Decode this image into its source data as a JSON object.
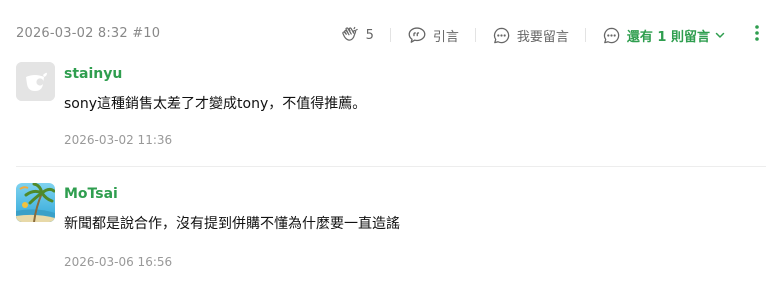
{
  "post": {
    "meta": "2026-03-02 8:32 #10",
    "clap_count": "5",
    "quote_label": "引言",
    "reply_label": "我要留言",
    "more_replies_label": "還有 1 則留言",
    "icons": [
      "clap-icon",
      "quote-icon",
      "comment-icon",
      "chevron-down-icon",
      "more-vertical-icon"
    ],
    "accent_color": "#2f9e4f"
  },
  "replies": [
    {
      "username": "stainyu",
      "content": "sony這種銷售太差了才變成tony，不值得推薦。",
      "time": "2026-03-02 11:36"
    },
    {
      "username": "MoTsai",
      "content": "新聞都是說合作，沒有提到併購不懂為什麼要一直造謠",
      "time": "2026-03-06 16:56"
    }
  ]
}
